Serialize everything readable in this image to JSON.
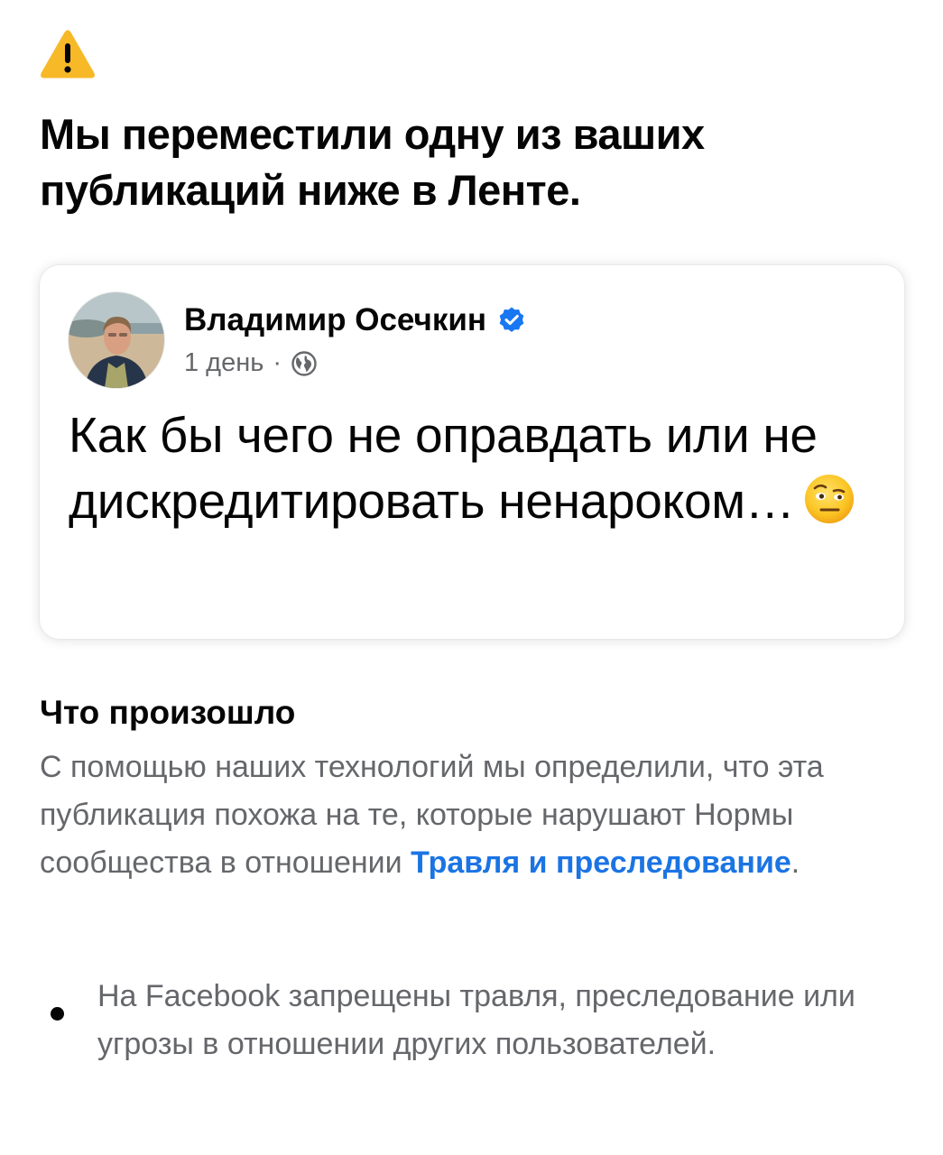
{
  "notice": {
    "icon": "warning-triangle-icon",
    "accent_color": "#f7b928",
    "headline": "Мы переместили одну из ваших публикаций ниже в Ленте."
  },
  "post": {
    "author_name": "Владимир Осечкин",
    "verified_icon": "verified-badge-icon",
    "verified_color": "#1877f2",
    "time": "1 день",
    "separator": "·",
    "audience_icon": "globe-icon",
    "text": "Как бы чего не оправдать или не дискредитировать ненароком…",
    "emoji": "face-with-raised-eyebrow-icon"
  },
  "what_happened": {
    "title": "Что произошло",
    "body": "С помощью наших технологий мы определили, что эта публикация похожа на те, которые нарушают Нормы сообщества в отношении",
    "link_label": "Травля и преследование",
    "link_color": "#1b74e4",
    "period": "."
  },
  "bullets": [
    {
      "text": "На Facebook запрещены травля, преследование или угрозы в отношении других пользователей."
    }
  ]
}
